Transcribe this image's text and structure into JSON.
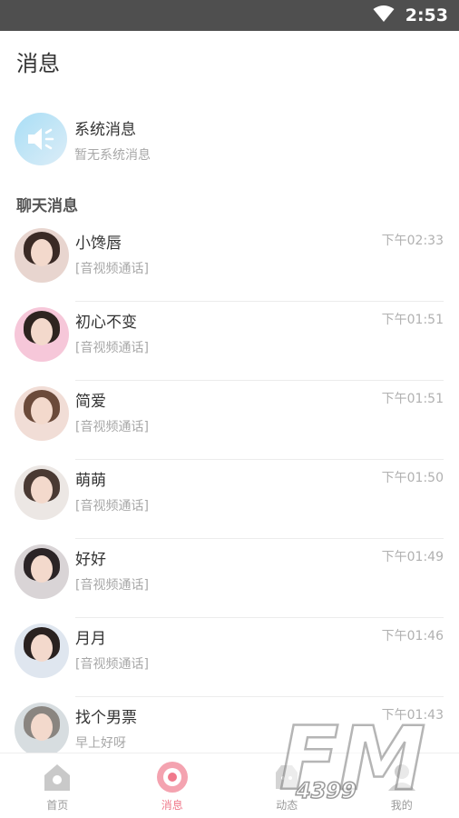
{
  "status_bar": {
    "time": "2:53",
    "icons": [
      "wifi-icon"
    ]
  },
  "header": {
    "title": "消息"
  },
  "system_message": {
    "icon": "speaker-icon",
    "title": "系统消息",
    "subtitle": "暂无系统消息"
  },
  "chat_section": {
    "title": "聊天消息"
  },
  "chats": [
    {
      "name": "小馋唇",
      "time": "下午02:33",
      "message": "[音视频通话]",
      "avatar_colors": [
        "#e8d5cf",
        "#3a2a25"
      ]
    },
    {
      "name": "初心不变",
      "time": "下午01:51",
      "message": "[音视频通话]",
      "avatar_colors": [
        "#f6c7d9",
        "#2e2420"
      ]
    },
    {
      "name": "简爱",
      "time": "下午01:51",
      "message": "[音视频通话]",
      "avatar_colors": [
        "#f1ddd6",
        "#6b4a3a"
      ]
    },
    {
      "name": "萌萌",
      "time": "下午01:50",
      "message": "[音视频通话]",
      "avatar_colors": [
        "#ece7e4",
        "#4a3a33"
      ]
    },
    {
      "name": "好好",
      "time": "下午01:49",
      "message": "[音视频通话]",
      "avatar_colors": [
        "#d9d4d6",
        "#2b2426"
      ]
    },
    {
      "name": "月月",
      "time": "下午01:46",
      "message": "[音视频通话]",
      "avatar_colors": [
        "#dfe6ef",
        "#2a2220"
      ]
    },
    {
      "name": "找个男票",
      "time": "下午01:43",
      "message": "早上好呀",
      "avatar_colors": [
        "#d7dde0",
        "#8a8580"
      ]
    }
  ],
  "bottom_nav": [
    {
      "label": "首页",
      "icon": "home-icon",
      "active": false
    },
    {
      "label": "消息",
      "icon": "message-icon",
      "active": true
    },
    {
      "label": "动态",
      "icon": "moments-icon",
      "active": false
    },
    {
      "label": "我的",
      "icon": "profile-icon",
      "active": false
    }
  ],
  "watermark": {
    "text": "FM",
    "subtext": "4399"
  },
  "colors": {
    "accent": "#f07a8c",
    "status_bar": "#4f4f4f"
  }
}
